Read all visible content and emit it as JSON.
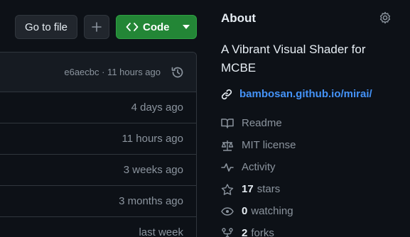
{
  "toolbar": {
    "go_to_file_label": "Go to file",
    "add_label": "+",
    "code_label": "Code",
    "code_button_color": "#238636"
  },
  "files": {
    "latest_commit": "e6aecbc · 11 hours ago",
    "rows": [
      {
        "date": "4 days ago"
      },
      {
        "date": "11 hours ago"
      },
      {
        "date": "3 weeks ago"
      },
      {
        "date": "3 months ago"
      },
      {
        "date": "last week"
      }
    ]
  },
  "about": {
    "title": "About",
    "description": "A Vibrant Visual Shader for MCBE",
    "link": "bambosan.github.io/mirai/",
    "link_color": "#4493f8",
    "readme": "Readme",
    "license": "MIT license",
    "activity": "Activity",
    "stars_count": "17",
    "stars_label": "stars",
    "watching_count": "0",
    "watching_label": "watching",
    "forks_count": "2",
    "forks_label": "forks"
  }
}
